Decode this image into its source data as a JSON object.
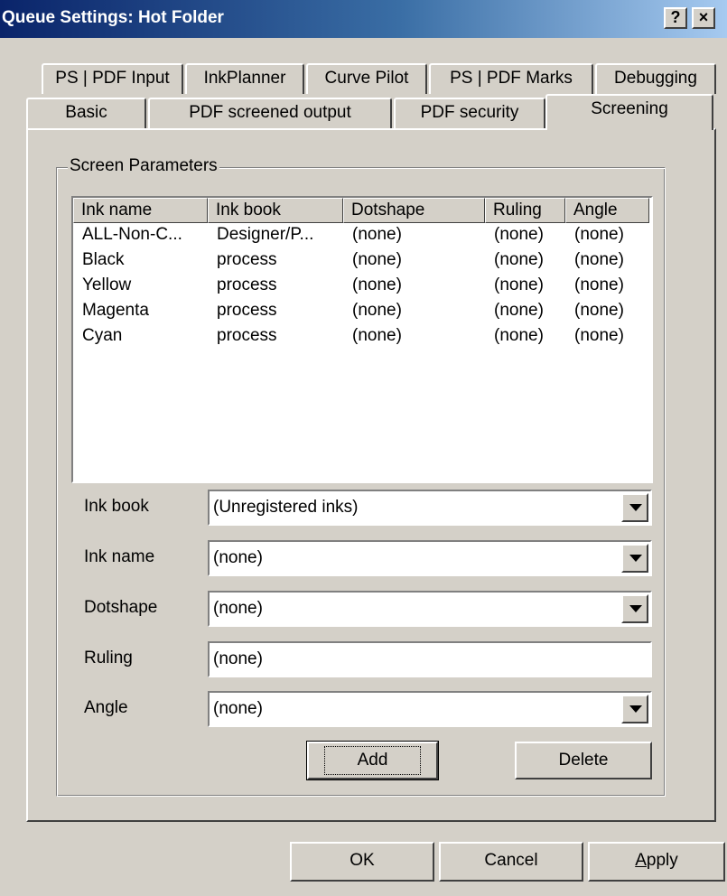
{
  "window": {
    "title": "Queue Settings: Hot Folder"
  },
  "title_buttons": {
    "help": "?",
    "close": "×"
  },
  "tabs_row1": [
    "PS | PDF Input",
    "InkPlanner",
    "Curve Pilot",
    "PS | PDF Marks",
    "Debugging"
  ],
  "tabs_row2": [
    "Basic",
    "PDF screened output",
    "PDF security",
    "Screening"
  ],
  "active_tab": "Screening",
  "group": {
    "label": "Screen Parameters"
  },
  "list": {
    "columns": [
      "Ink name",
      "Ink book",
      "Dotshape",
      "Ruling",
      "Angle"
    ],
    "rows": [
      [
        "ALL-Non-C...",
        "Designer/P...",
        "(none)",
        "(none)",
        "(none)"
      ],
      [
        "Black",
        "process",
        "(none)",
        "(none)",
        "(none)"
      ],
      [
        "Yellow",
        "process",
        "(none)",
        "(none)",
        "(none)"
      ],
      [
        "Magenta",
        "process",
        "(none)",
        "(none)",
        "(none)"
      ],
      [
        "Cyan",
        "process",
        "(none)",
        "(none)",
        "(none)"
      ]
    ]
  },
  "fields": {
    "ink_book": {
      "label": "Ink book",
      "value": "(Unregistered inks)"
    },
    "ink_name": {
      "label": "Ink name",
      "value": "(none)"
    },
    "dotshape": {
      "label": "Dotshape",
      "value": "(none)"
    },
    "ruling": {
      "label": "Ruling",
      "value": "(none)"
    },
    "angle": {
      "label": "Angle",
      "value": "(none)"
    }
  },
  "buttons": {
    "add": "Add",
    "delete": "Delete",
    "ok": "OK",
    "cancel": "Cancel",
    "apply_prefix": "",
    "apply_mnemonic": "A",
    "apply_rest": "pply"
  },
  "colors": {
    "titlebar_start": "#0a246a",
    "titlebar_end": "#a6caf0",
    "face": "#d4d0c8"
  }
}
